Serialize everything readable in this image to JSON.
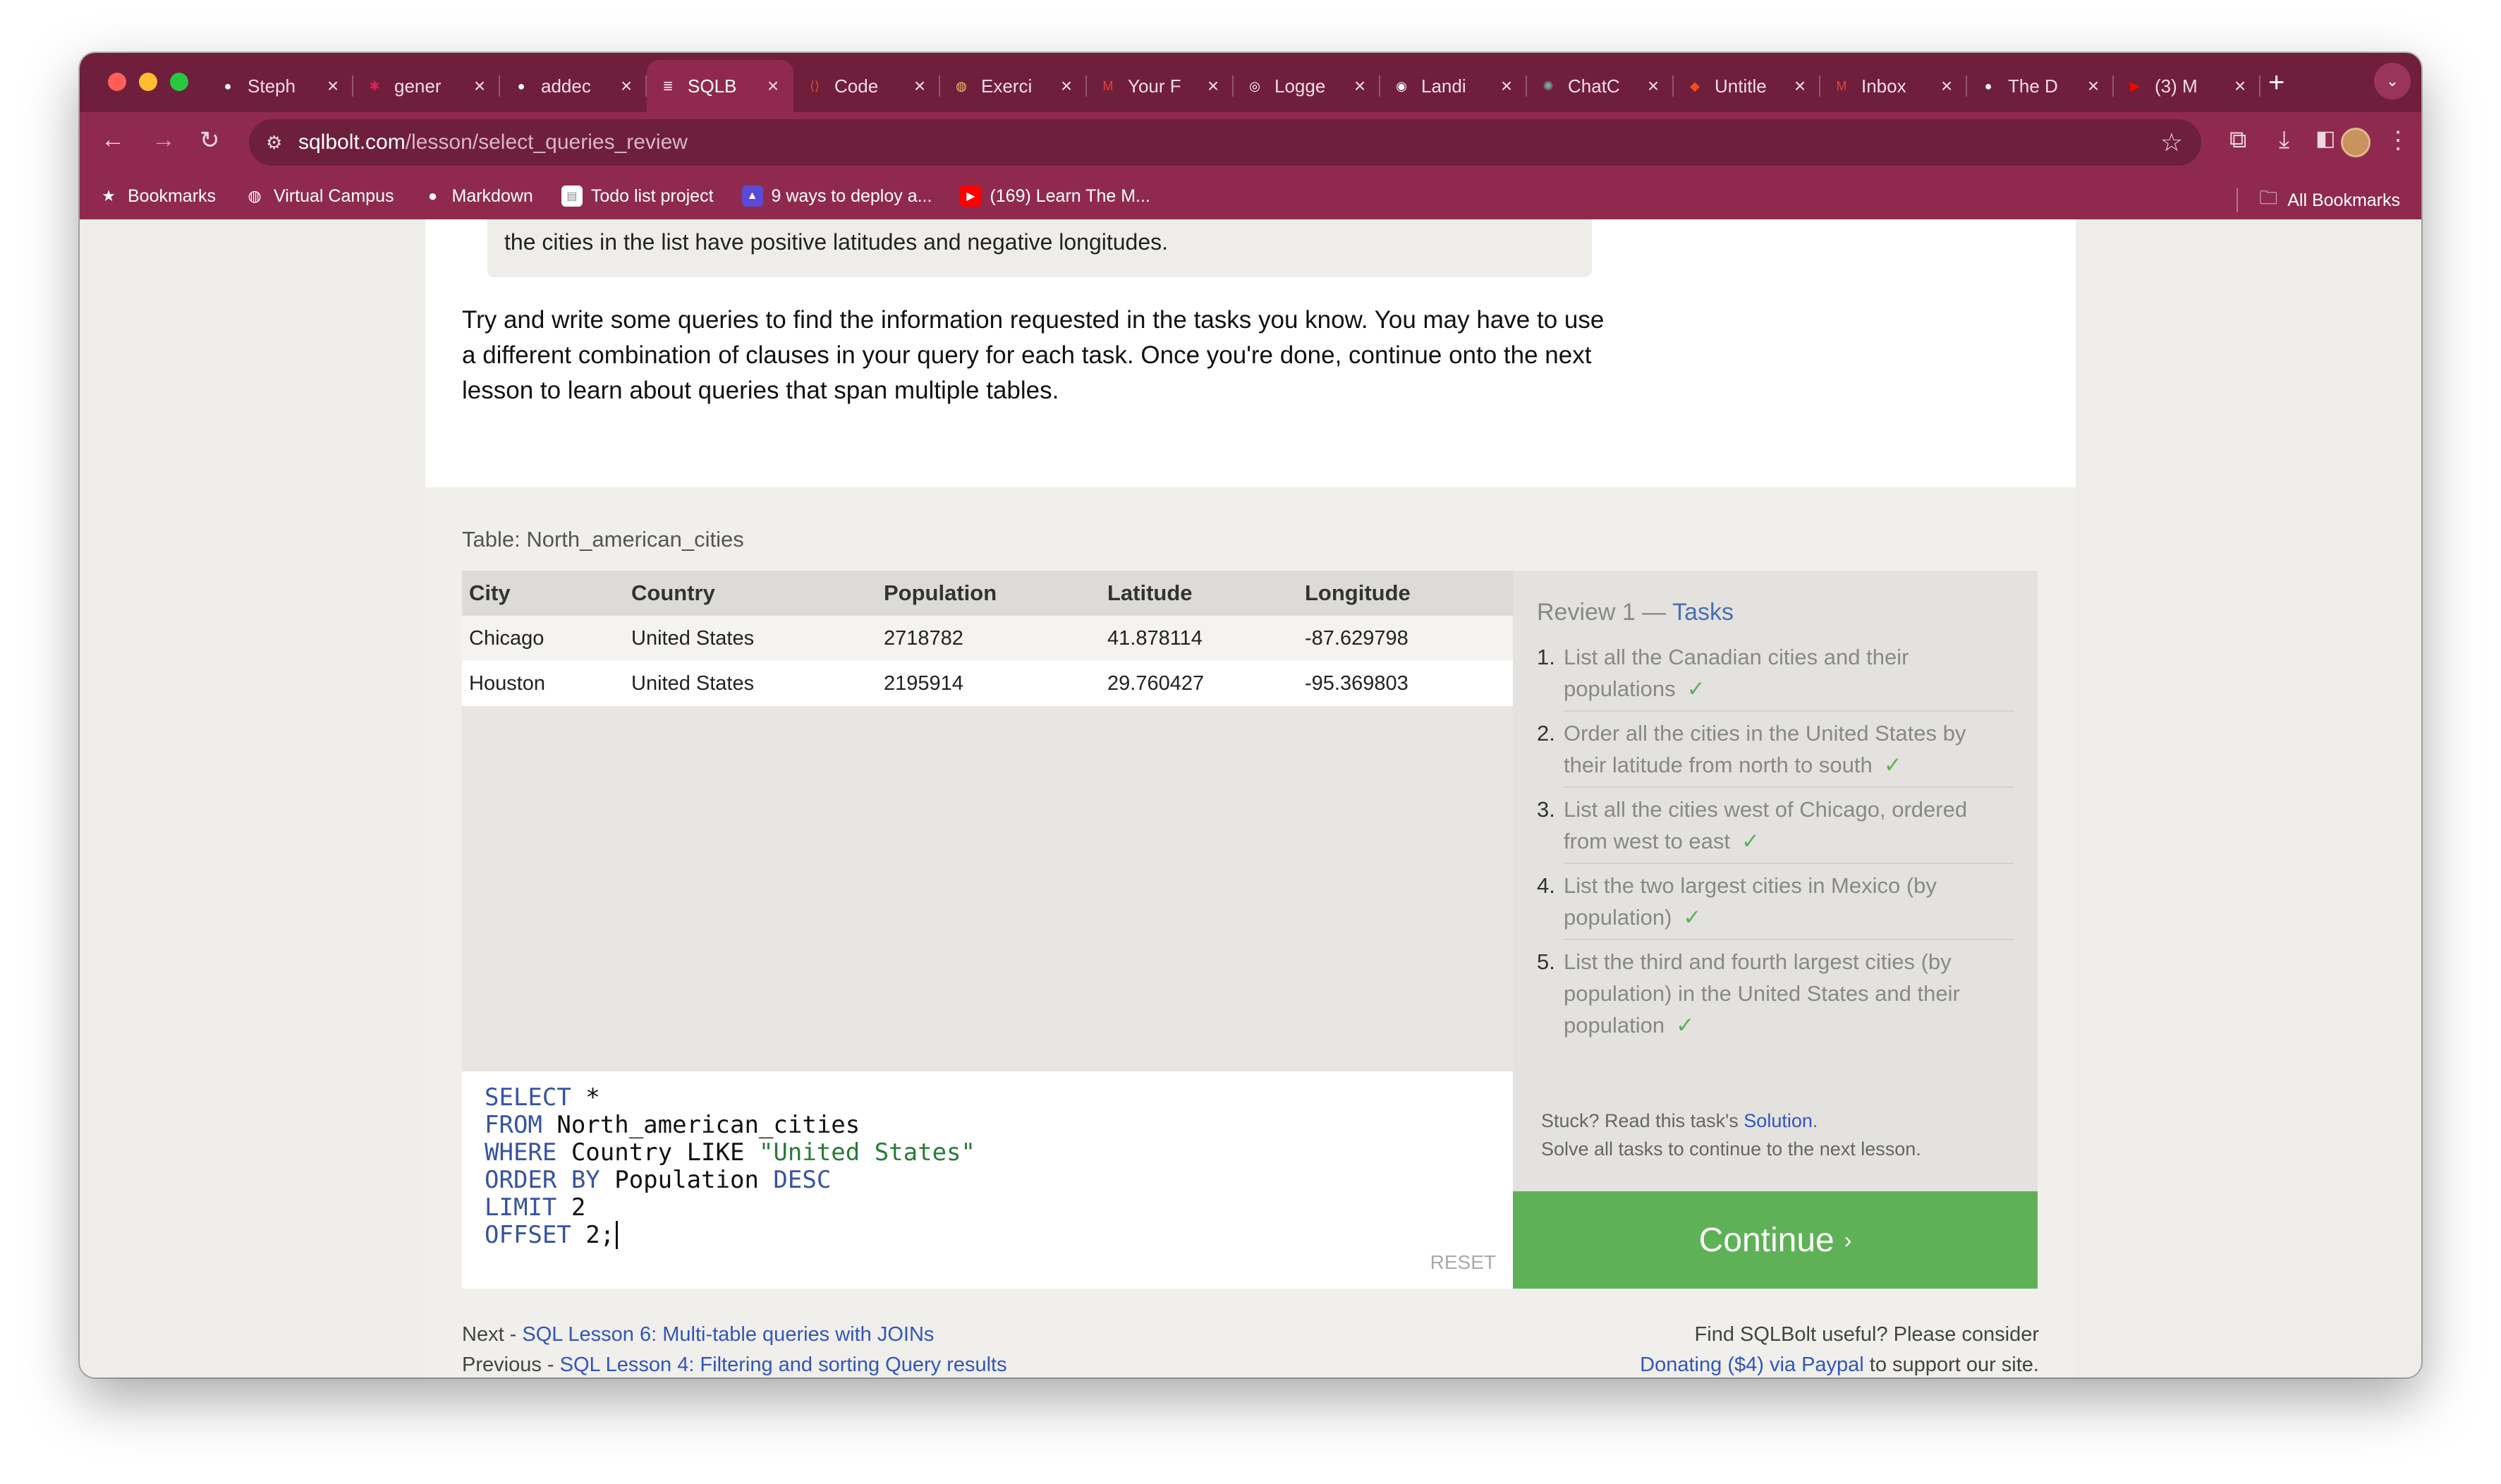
{
  "browser": {
    "tabs": [
      {
        "title": "Steph",
        "icon": "github-icon",
        "color": "#ffffff"
      },
      {
        "title": "gener",
        "icon": "slack-icon",
        "color": "#e01e5a"
      },
      {
        "title": "addec",
        "icon": "github-icon",
        "color": "#ffffff"
      },
      {
        "title": "SQLB",
        "icon": "database-icon",
        "color": "#ffffff",
        "active": true
      },
      {
        "title": "Code",
        "icon": "code-icon",
        "color": "#e44d26"
      },
      {
        "title": "Exerci",
        "icon": "globe-icon",
        "color": "#f3c26b"
      },
      {
        "title": "Your F",
        "icon": "gmail-icon",
        "color": "#ea4335"
      },
      {
        "title": "Logge",
        "icon": "hc-icon",
        "color": "#ffffff"
      },
      {
        "title": "Landi",
        "icon": "portfolio-icon",
        "color": "#ffffff"
      },
      {
        "title": "ChatC",
        "icon": "chatgpt-icon",
        "color": "#74aa9c"
      },
      {
        "title": "Untitle",
        "icon": "figma-icon",
        "color": "#f24e1e"
      },
      {
        "title": "Inbox",
        "icon": "gmail-icon",
        "color": "#ea4335"
      },
      {
        "title": "The D",
        "icon": "github-icon",
        "color": "#ffffff"
      },
      {
        "title": "(3) M",
        "icon": "youtube-icon",
        "color": "#ff0000"
      }
    ],
    "url_host": "sqlbolt.com",
    "url_path": "/lesson/select_queries_review",
    "bookmarks": [
      {
        "label": "Bookmarks",
        "icon": "star-icon"
      },
      {
        "label": "Virtual Campus",
        "icon": "globe-icon"
      },
      {
        "label": "Markdown",
        "icon": "github-icon"
      },
      {
        "label": "Todo list project",
        "icon": "note-icon"
      },
      {
        "label": "9 ways to deploy a...",
        "icon": "rocket-icon"
      },
      {
        "label": "(169) Learn The M...",
        "icon": "youtube-icon"
      }
    ],
    "all_bookmarks": "All Bookmarks"
  },
  "lesson": {
    "note_text": "the cities in the list have positive latitudes and negative longitudes.",
    "paragraph": "Try and write some queries to find the information requested in the tasks you know. You may have to use a different combination of clauses in your query for each task. Once you're done, continue onto the next lesson to learn about queries that span multiple tables."
  },
  "table": {
    "caption": "Table: North_american_cities",
    "columns": [
      "City",
      "Country",
      "Population",
      "Latitude",
      "Longitude"
    ],
    "rows": [
      [
        "Chicago",
        "United States",
        "2718782",
        "41.878114",
        "-87.629798"
      ],
      [
        "Houston",
        "United States",
        "2195914",
        "29.760427",
        "-95.369803"
      ]
    ]
  },
  "editor": {
    "lines": [
      {
        "kw": "SELECT",
        "rest": " *"
      },
      {
        "kw": "FROM",
        "rest": " North_american_cities"
      },
      {
        "kw": "WHERE",
        "rest": " Country LIKE ",
        "str": "\"United States\""
      },
      {
        "kw": "ORDER BY",
        "rest": " Population ",
        "kw2": "DESC"
      },
      {
        "kw": "LIMIT",
        "rest": " 2"
      },
      {
        "kw": "OFFSET",
        "rest": " 2;"
      }
    ],
    "reset_label": "RESET"
  },
  "tasks": {
    "title_a": "Review 1 — ",
    "title_b": "Tasks",
    "items": [
      {
        "num": "1.",
        "text": "List all the Canadian cities and their populations",
        "done": "✓"
      },
      {
        "num": "2.",
        "text": "Order all the cities in the United States by their latitude from north to south",
        "done": "✓"
      },
      {
        "num": "3.",
        "text": "List all the cities west of Chicago, ordered from west to east",
        "done": "✓"
      },
      {
        "num": "4.",
        "text": "List the two largest cities in Mexico (by population)",
        "done": "✓"
      },
      {
        "num": "5.",
        "text": "List the third and fourth largest cities (by population) in the United States and their population",
        "done": "✓"
      }
    ],
    "stuck_text": "Stuck? Read this task's ",
    "solution_link": "Solution",
    "solve_text": "Solve all tasks to continue to the next lesson."
  },
  "continue_label": "Continue",
  "footer": {
    "next_prefix": "Next - ",
    "next_link": "SQL Lesson 6: Multi-table queries with JOINs",
    "prev_prefix": "Previous - ",
    "prev_link": "SQL Lesson 4: Filtering and sorting Query results",
    "support_line": "Find SQLBolt useful? Please consider",
    "donate_link": "Donating ($4) via Paypal",
    "support_suffix": " to support our site."
  }
}
